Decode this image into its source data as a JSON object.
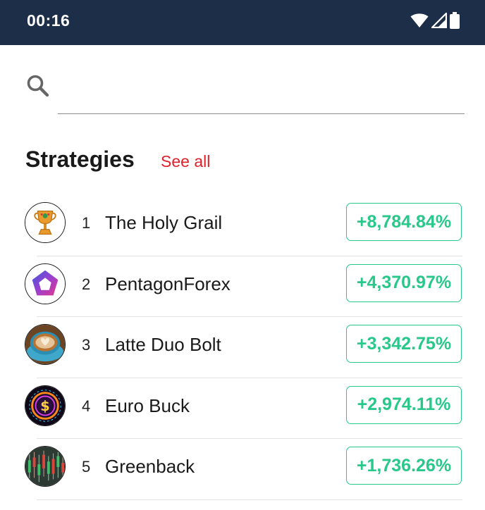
{
  "status_bar": {
    "time": "00:16",
    "icons": [
      "wifi-icon",
      "signal-icon",
      "battery-icon"
    ],
    "background": "#1d2e48"
  },
  "search": {
    "placeholder": "",
    "value": "",
    "icon": "search-icon"
  },
  "strategies": {
    "title": "Strategies",
    "see_all_label": "See all",
    "accent_color": "#e0202c",
    "positive_color": "#27c88a",
    "items": [
      {
        "rank": "1",
        "name": "The Holy Grail",
        "performance": "+8,784.84%",
        "avatar": "trophy-icon"
      },
      {
        "rank": "2",
        "name": "PentagonForex",
        "performance": "+4,370.97%",
        "avatar": "pentagon-logo-icon"
      },
      {
        "rank": "3",
        "name": "Latte Duo Bolt",
        "performance": "+3,342.75%",
        "avatar": "latte-cup-icon"
      },
      {
        "rank": "4",
        "name": "Euro Buck",
        "performance": "+2,974.11%",
        "avatar": "dollar-coin-icon"
      },
      {
        "rank": "5",
        "name": "Greenback",
        "performance": "+1,736.26%",
        "avatar": "candlestick-chart-icon"
      }
    ]
  }
}
